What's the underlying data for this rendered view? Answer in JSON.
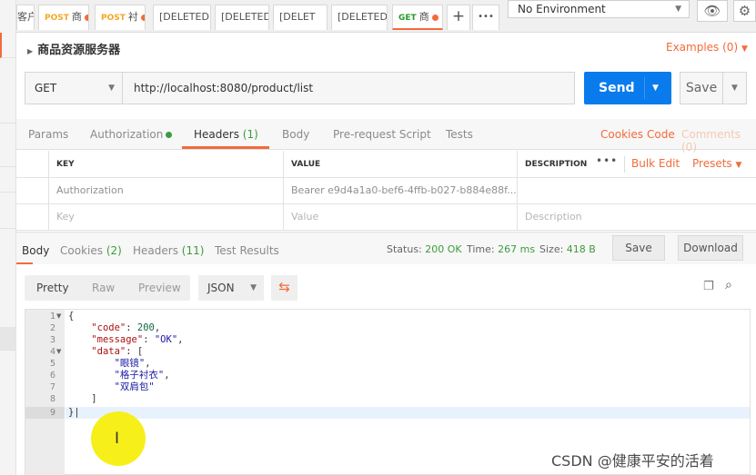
{
  "tabs": [
    {
      "label": "客户",
      "method": "",
      "dirty": false
    },
    {
      "label": "商",
      "method": "POST",
      "dirty": true
    },
    {
      "label": "衬",
      "method": "POST",
      "dirty": true
    },
    {
      "label": "[DELETED]",
      "method": "",
      "dirty": false
    },
    {
      "label": "[DELETED]",
      "method": "",
      "dirty": false
    },
    {
      "label": "[DELET",
      "method": "",
      "dirty": false
    },
    {
      "label": "[DELETED]",
      "method": "",
      "dirty": false
    },
    {
      "label": "商",
      "method": "GET",
      "dirty": true
    }
  ],
  "tab_add_icon": "+",
  "tab_more_icon": "•••",
  "environment": {
    "selected": "No Environment"
  },
  "request": {
    "name": "商品资源服务器",
    "examples_label": "Examples (0)",
    "method": "GET",
    "url": "http://localhost:8080/product/list",
    "send_label": "Send",
    "save_label": "Save"
  },
  "request_tabs": {
    "params": "Params",
    "authorization": "Authorization",
    "headers": "Headers",
    "headers_count": "(1)",
    "body": "Body",
    "prerequest": "Pre-request Script",
    "tests": "Tests",
    "cookies": "Cookies",
    "code": "Code",
    "comments": "Comments (0)"
  },
  "headers_table": {
    "columns": [
      "KEY",
      "VALUE",
      "DESCRIPTION"
    ],
    "more": "•••",
    "bulk_edit": "Bulk Edit",
    "presets": "Presets",
    "rows": [
      {
        "key": "Authorization",
        "value": "Bearer e9d4a1a0-bef6-4ffb-b027-b884e88f...",
        "description": ""
      }
    ],
    "placeholder": {
      "key": "Key",
      "value": "Value",
      "description": "Description"
    }
  },
  "response": {
    "tabs": {
      "body": "Body",
      "cookies": "Cookies",
      "cookies_count": "(2)",
      "headers": "Headers",
      "headers_count": "(11)",
      "tests": "Test Results"
    },
    "status_label": "Status:",
    "status": "200 OK",
    "time_label": "Time:",
    "time": "267 ms",
    "size_label": "Size:",
    "size": "418 B",
    "save_label": "Save",
    "download_label": "Download",
    "view_modes": [
      "Pretty",
      "Raw",
      "Preview"
    ],
    "format": "JSON",
    "lines": [
      "1",
      "2",
      "3",
      "4",
      "5",
      "6",
      "7",
      "8",
      "9"
    ]
  },
  "code": {
    "open": "{",
    "code_key": "\"code\"",
    "code_val": "200",
    "message_key": "\"message\"",
    "message_val": "\"OK\"",
    "data_key": "\"data\"",
    "item1": "\"眼镜\"",
    "item2": "\"格子衬衣\"",
    "item3": "\"双肩包\"",
    "array_close": "]",
    "close": "}"
  },
  "watermark": "CSDN @健康平安的活着",
  "colors": {
    "accent": "#f26b3a",
    "send": "#097bed",
    "ok": "#3b9c3b"
  }
}
